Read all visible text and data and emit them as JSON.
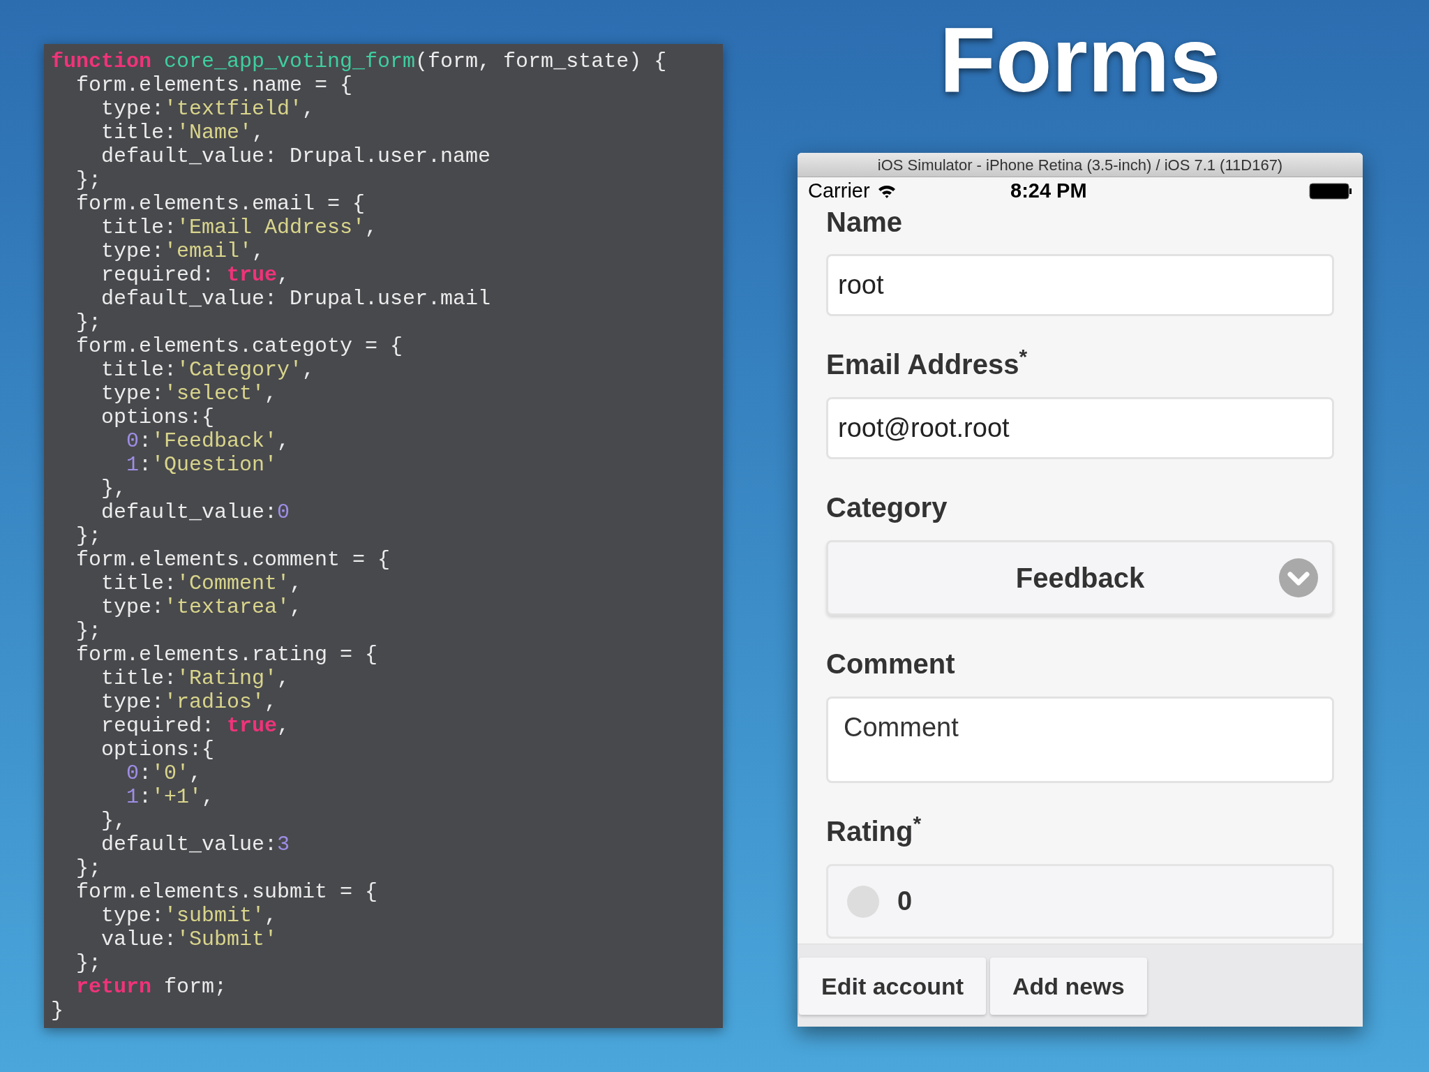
{
  "slide_title": "Forms",
  "code": {
    "lines": [
      [
        {
          "kind": "keyword",
          "text": "function"
        },
        {
          "kind": "function",
          "text": " core_app_voting_form"
        },
        {
          "kind": "plain",
          "text": "(form, form_state) {"
        }
      ],
      [
        {
          "kind": "plain",
          "text": "  form.elements.name = {"
        }
      ],
      [
        {
          "kind": "plain",
          "text": "    type:"
        },
        {
          "kind": "string",
          "text": "'textfield'"
        },
        {
          "kind": "plain",
          "text": ","
        }
      ],
      [
        {
          "kind": "plain",
          "text": "    title:"
        },
        {
          "kind": "string",
          "text": "'Name'"
        },
        {
          "kind": "plain",
          "text": ","
        }
      ],
      [
        {
          "kind": "plain",
          "text": "    default_value: Drupal.user.name"
        }
      ],
      [
        {
          "kind": "plain",
          "text": "  };"
        }
      ],
      [
        {
          "kind": "plain",
          "text": "  form.elements.email = {"
        }
      ],
      [
        {
          "kind": "plain",
          "text": "    title:"
        },
        {
          "kind": "string",
          "text": "'Email Address'"
        },
        {
          "kind": "plain",
          "text": ","
        }
      ],
      [
        {
          "kind": "plain",
          "text": "    type:"
        },
        {
          "kind": "string",
          "text": "'email'"
        },
        {
          "kind": "plain",
          "text": ","
        }
      ],
      [
        {
          "kind": "plain",
          "text": "    required: "
        },
        {
          "kind": "keyword",
          "text": "true"
        },
        {
          "kind": "plain",
          "text": ","
        }
      ],
      [
        {
          "kind": "plain",
          "text": "    default_value: Drupal.user.mail"
        }
      ],
      [
        {
          "kind": "plain",
          "text": "  };"
        }
      ],
      [
        {
          "kind": "plain",
          "text": "  form.elements.categoty = {"
        }
      ],
      [
        {
          "kind": "plain",
          "text": "    title:"
        },
        {
          "kind": "string",
          "text": "'Category'"
        },
        {
          "kind": "plain",
          "text": ","
        }
      ],
      [
        {
          "kind": "plain",
          "text": "    type:"
        },
        {
          "kind": "string",
          "text": "'select'"
        },
        {
          "kind": "plain",
          "text": ","
        }
      ],
      [
        {
          "kind": "plain",
          "text": "    options:{"
        }
      ],
      [
        {
          "kind": "number",
          "text": "      0"
        },
        {
          "kind": "plain",
          "text": ":"
        },
        {
          "kind": "string",
          "text": "'Feedback'"
        },
        {
          "kind": "plain",
          "text": ","
        }
      ],
      [
        {
          "kind": "number",
          "text": "      1"
        },
        {
          "kind": "plain",
          "text": ":"
        },
        {
          "kind": "string",
          "text": "'Question'"
        }
      ],
      [
        {
          "kind": "plain",
          "text": "    },"
        }
      ],
      [
        {
          "kind": "plain",
          "text": "    default_value:"
        },
        {
          "kind": "number",
          "text": "0"
        }
      ],
      [
        {
          "kind": "plain",
          "text": "  };"
        }
      ],
      [
        {
          "kind": "plain",
          "text": "  form.elements.comment = {"
        }
      ],
      [
        {
          "kind": "plain",
          "text": "    title:"
        },
        {
          "kind": "string",
          "text": "'Comment'"
        },
        {
          "kind": "plain",
          "text": ","
        }
      ],
      [
        {
          "kind": "plain",
          "text": "    type:"
        },
        {
          "kind": "string",
          "text": "'textarea'"
        },
        {
          "kind": "plain",
          "text": ","
        }
      ],
      [
        {
          "kind": "plain",
          "text": "  };"
        }
      ],
      [
        {
          "kind": "plain",
          "text": "  form.elements.rating = {"
        }
      ],
      [
        {
          "kind": "plain",
          "text": "    title:"
        },
        {
          "kind": "string",
          "text": "'Rating'"
        },
        {
          "kind": "plain",
          "text": ","
        }
      ],
      [
        {
          "kind": "plain",
          "text": "    type:"
        },
        {
          "kind": "string",
          "text": "'radios'"
        },
        {
          "kind": "plain",
          "text": ","
        }
      ],
      [
        {
          "kind": "plain",
          "text": "    required: "
        },
        {
          "kind": "keyword",
          "text": "true"
        },
        {
          "kind": "plain",
          "text": ","
        }
      ],
      [
        {
          "kind": "plain",
          "text": "    options:{"
        }
      ],
      [
        {
          "kind": "number",
          "text": "      0"
        },
        {
          "kind": "plain",
          "text": ":"
        },
        {
          "kind": "string",
          "text": "'0'"
        },
        {
          "kind": "plain",
          "text": ","
        }
      ],
      [
        {
          "kind": "number",
          "text": "      1"
        },
        {
          "kind": "plain",
          "text": ":"
        },
        {
          "kind": "string",
          "text": "'+1'"
        },
        {
          "kind": "plain",
          "text": ","
        }
      ],
      [
        {
          "kind": "plain",
          "text": "    },"
        }
      ],
      [
        {
          "kind": "plain",
          "text": "    default_value:"
        },
        {
          "kind": "number",
          "text": "3"
        }
      ],
      [
        {
          "kind": "plain",
          "text": "  };"
        }
      ],
      [
        {
          "kind": "plain",
          "text": "  form.elements.submit = {"
        }
      ],
      [
        {
          "kind": "plain",
          "text": "    type:"
        },
        {
          "kind": "string",
          "text": "'submit'"
        },
        {
          "kind": "plain",
          "text": ","
        }
      ],
      [
        {
          "kind": "plain",
          "text": "    value:"
        },
        {
          "kind": "string",
          "text": "'Submit'"
        }
      ],
      [
        {
          "kind": "plain",
          "text": "  };"
        }
      ],
      [
        {
          "kind": "keyword",
          "text": "  return"
        },
        {
          "kind": "plain",
          "text": " form;"
        }
      ],
      [
        {
          "kind": "plain",
          "text": "}"
        }
      ]
    ]
  },
  "simulator": {
    "window_title": "iOS Simulator - iPhone Retina (3.5-inch) / iOS 7.1 (11D167)",
    "status_bar": {
      "carrier": "Carrier",
      "time": "8:24 PM"
    },
    "fields": [
      {
        "kind": "text",
        "label": "Name",
        "value": "root"
      },
      {
        "kind": "text",
        "label": "Email Address$^{*}$",
        "value": "root@root.root"
      },
      {
        "kind": "select",
        "label": "Category",
        "value": "Feedback"
      },
      {
        "kind": "textarea",
        "label": "Comment",
        "value": "Comment"
      },
      {
        "kind": "radios",
        "label": "Rating$^{*}$",
        "options": [
          {
            "label": "0",
            "selected": false
          }
        ]
      }
    ],
    "footer_buttons": [
      "Edit account",
      "Add news"
    ]
  }
}
